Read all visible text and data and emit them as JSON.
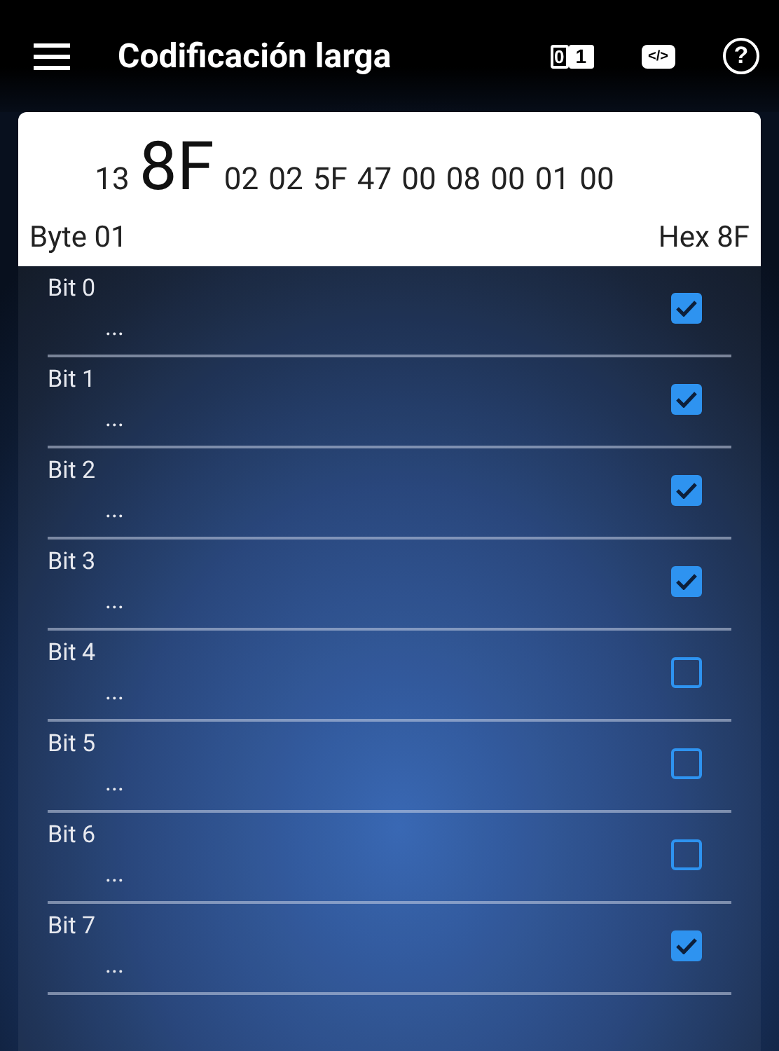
{
  "app_bar": {
    "title": "Codificación larga",
    "binary_badge": [
      "0",
      "1"
    ],
    "code_badge": "</>",
    "help": "?"
  },
  "header": {
    "bytes_before": [
      "13"
    ],
    "current": "8F",
    "bytes_after": [
      "02",
      "02",
      "5F",
      "47",
      "00",
      "08",
      "00",
      "01",
      "00"
    ],
    "byte_label": "Byte 01",
    "hex_label": "Hex 8F"
  },
  "bits": [
    {
      "label": "Bit 0",
      "value": "...",
      "checked": true
    },
    {
      "label": "Bit 1",
      "value": "...",
      "checked": true
    },
    {
      "label": "Bit 2",
      "value": "...",
      "checked": true
    },
    {
      "label": "Bit 3",
      "value": "...",
      "checked": true
    },
    {
      "label": "Bit 4",
      "value": "...",
      "checked": false
    },
    {
      "label": "Bit 5",
      "value": "...",
      "checked": false
    },
    {
      "label": "Bit 6",
      "value": "...",
      "checked": false
    },
    {
      "label": "Bit 7",
      "value": "...",
      "checked": true
    }
  ]
}
